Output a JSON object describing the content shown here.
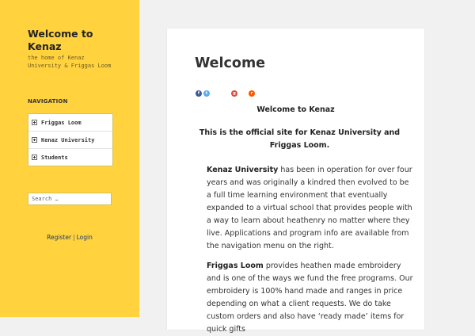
{
  "site": {
    "title": "Welcome to\nKenaz",
    "description": "the home of Kenaz University & Friggas Loom"
  },
  "navigation": {
    "heading": "NAVIGATION",
    "items": [
      {
        "label": "Friggas Loom"
      },
      {
        "label": "Kenaz University"
      },
      {
        "label": "Students"
      }
    ]
  },
  "search": {
    "placeholder": "Search …"
  },
  "auth": {
    "register": "Register",
    "separator": "|",
    "login": "Login"
  },
  "page": {
    "title": "Welcome",
    "share_icons": [
      "facebook-icon",
      "twitter-icon",
      "google-plus-icon",
      "reddit-icon"
    ],
    "welcome_heading": "Welcome to Kenaz",
    "official_line": "This is the official site for Kenaz University and Friggas Loom.",
    "para1": {
      "bold": "Kenaz University",
      "text": " has been in operation for over four years and was originally a kindred then evolved to be a full time learning environment that eventually expanded to a virtual school that provides people with a way to learn about heathenry no matter where they live. Applications and program info are available from the navigation menu on the right."
    },
    "para2": {
      "bold": "Friggas Loom",
      "text": " provides heathen made embroidery and is one of the ways we fund the free programs. Our embroidery is 100% hand made and ranges in price depending on what a client requests. We do take custom orders and also have ‘ready made’ items for quick gifts"
    }
  },
  "colors": {
    "sidebar": "#ffd23e",
    "background": "#f1f1f1",
    "link": "#1e3b6e"
  }
}
